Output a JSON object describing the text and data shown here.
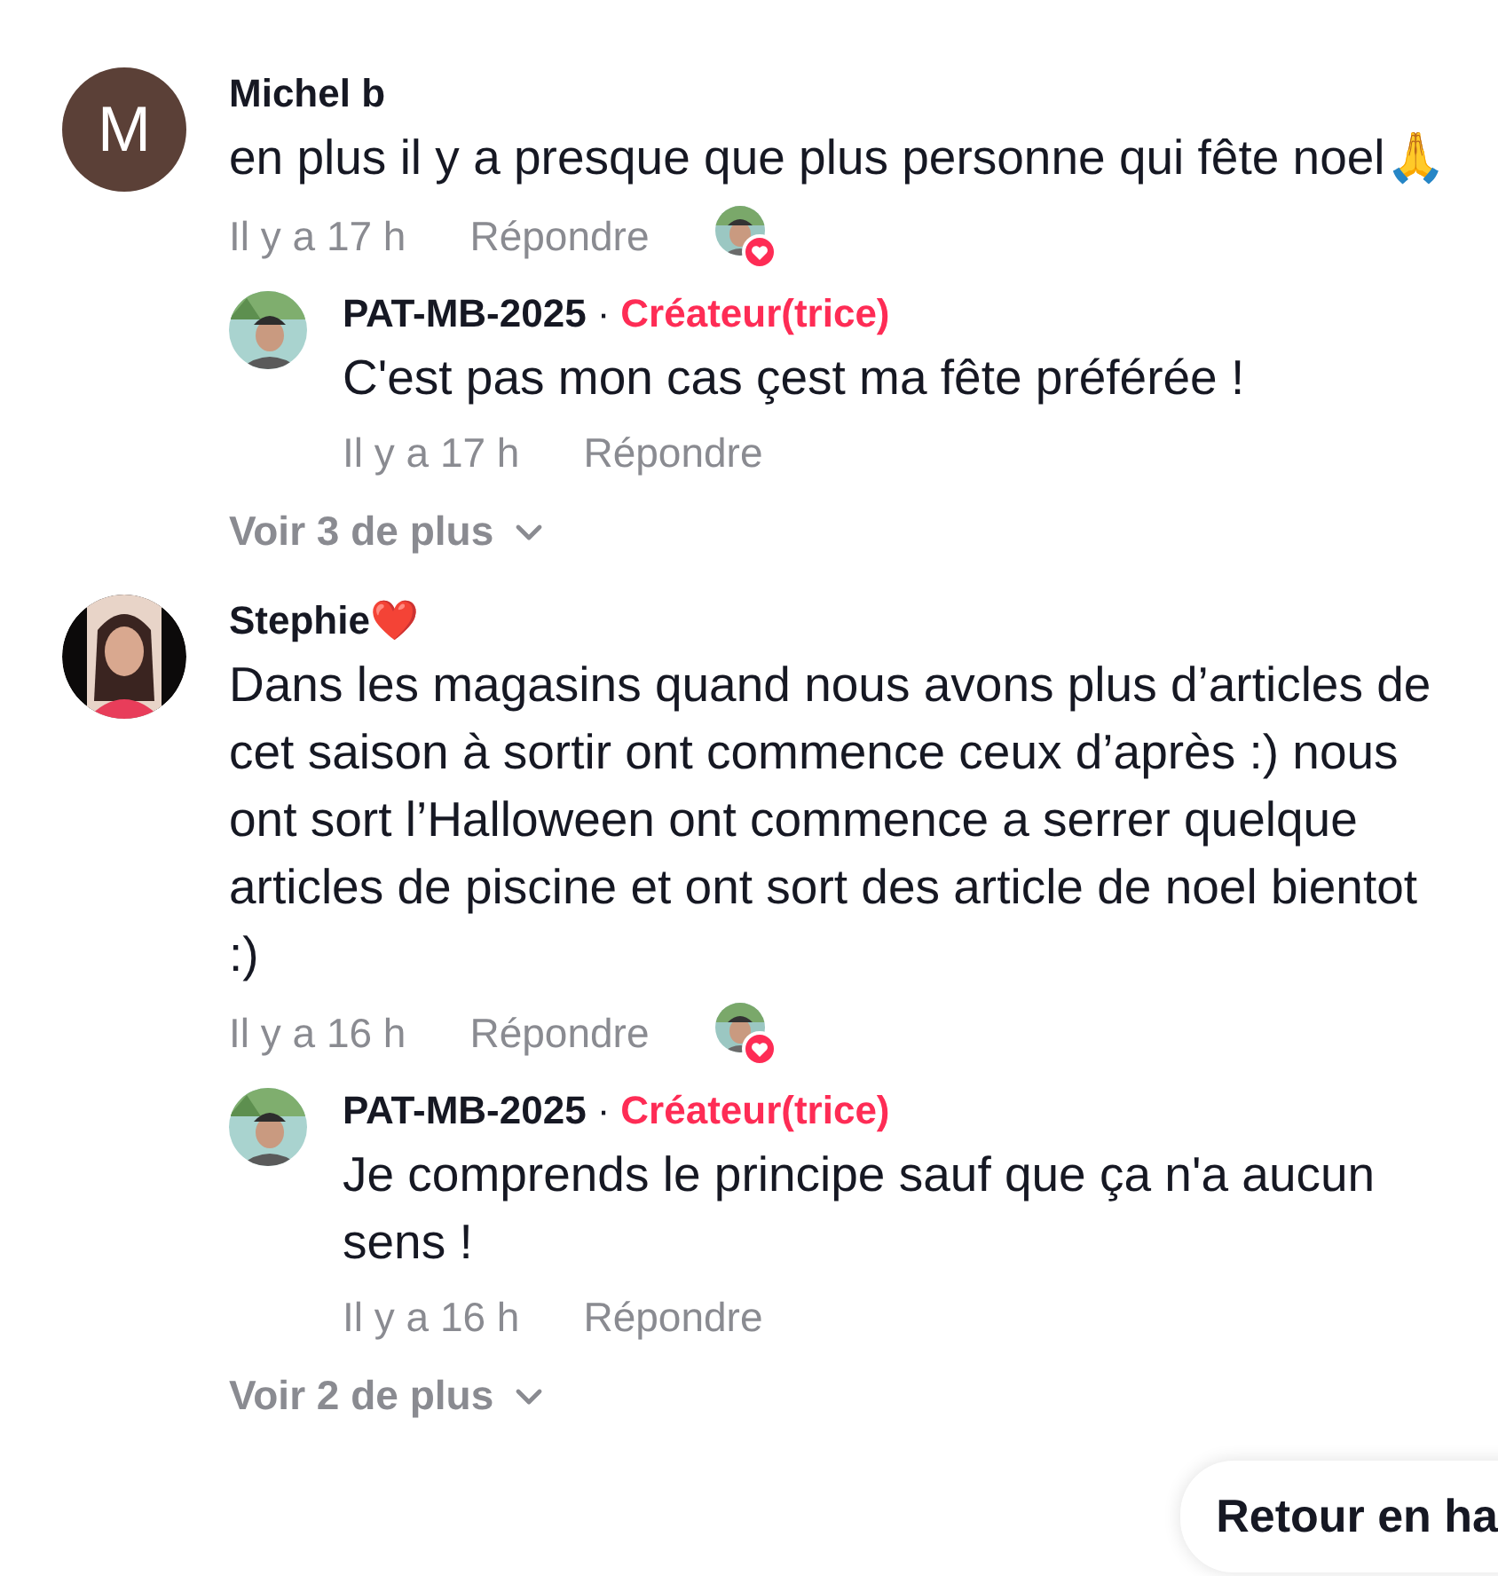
{
  "comments": [
    {
      "avatar": {
        "kind": "letter",
        "letter": "M"
      },
      "author": "Michel b",
      "text": "en plus il y a presque que plus personne qui fête noel🙏",
      "time": "Il y a 17 h",
      "reply_label": "Répondre",
      "creator_liked": true,
      "replies": [
        {
          "author": "PAT-MB-2025",
          "separator": "·",
          "badge": "Créateur(trice)",
          "text": "C'est pas mon cas çest ma fête préférée !",
          "time": "Il y a 17 h",
          "reply_label": "Répondre"
        }
      ],
      "more_label": "Voir 3 de plus"
    },
    {
      "avatar": {
        "kind": "picture"
      },
      "author": "Stephie❤️",
      "text": "Dans les magasins quand nous avons plus d’articles de cet saison à sortir ont commence ceux d’après :) nous ont sort l’Halloween ont commence a serrer quelque articles de piscine et ont sort des article de noel bientot :)",
      "time": "Il y a 16 h",
      "reply_label": "Répondre",
      "creator_liked": true,
      "replies": [
        {
          "author": "PAT-MB-2025",
          "separator": "·",
          "badge": "Créateur(trice)",
          "text": "Je comprends le principe sauf que ça n'a aucun sens !",
          "time": "Il y a 16 h",
          "reply_label": "Répondre"
        }
      ],
      "more_label": "Voir 2 de plus"
    }
  ],
  "back_to_top": "Retour en ha"
}
